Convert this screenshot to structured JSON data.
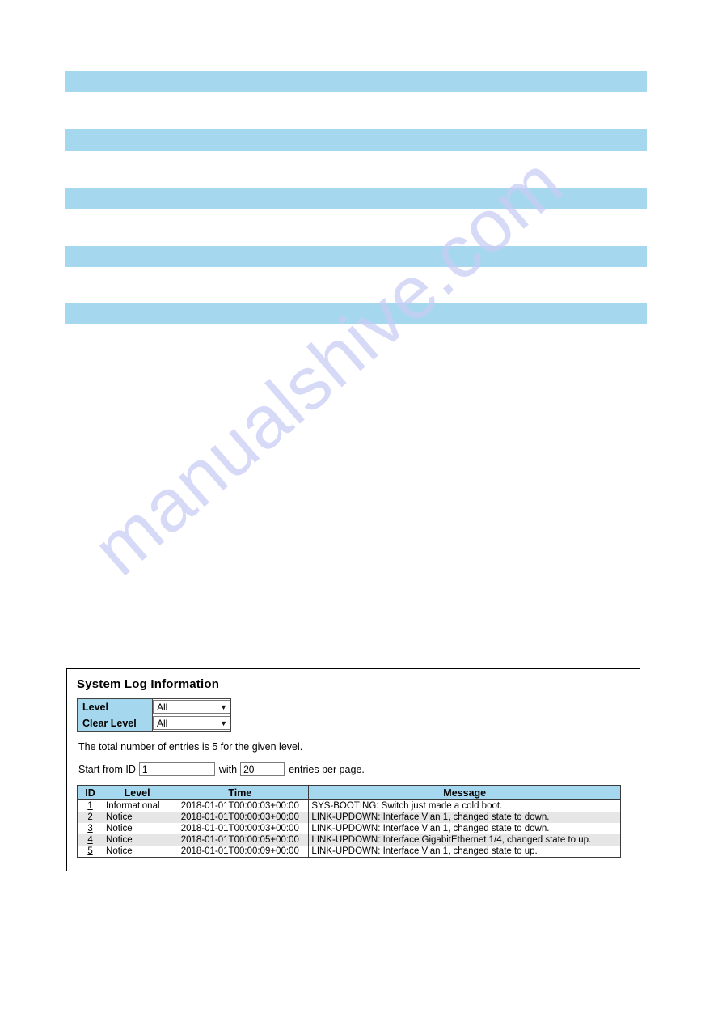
{
  "page": {
    "watermark_text": "manualshive.com",
    "redacted_bar_color": "#a5d8ef",
    "header_blue": "#a5d8ef",
    "alt_row_gray": "#e6e6e6"
  },
  "redacted_bars": [
    {
      "id": "bar-1"
    },
    {
      "id": "bar-2"
    },
    {
      "id": "bar-3"
    },
    {
      "id": "bar-4"
    },
    {
      "id": "bar-5"
    }
  ],
  "panel": {
    "title": "System Log Information",
    "level_form": {
      "rows": [
        {
          "label": "Level",
          "value": "All",
          "caret": "▼"
        },
        {
          "label": "Clear Level",
          "value": "All",
          "caret": "▼"
        }
      ]
    },
    "total_text": "The total number of entries is 5 for the given level.",
    "paging": {
      "prefix": "Start from ID",
      "start_id": "1",
      "middle": "with",
      "per_page": "20",
      "suffix": "entries per page."
    },
    "log_table": {
      "columns": [
        "ID",
        "Level",
        "Time",
        "Message"
      ],
      "rows": [
        {
          "id": "1",
          "level": "Informational",
          "time": "2018-01-01T00:00:03+00:00",
          "message": "SYS-BOOTING: Switch just made a cold boot."
        },
        {
          "id": "2",
          "level": "Notice",
          "time": "2018-01-01T00:00:03+00:00",
          "message": "LINK-UPDOWN: Interface Vlan 1, changed state to down."
        },
        {
          "id": "3",
          "level": "Notice",
          "time": "2018-01-01T00:00:03+00:00",
          "message": "LINK-UPDOWN: Interface Vlan 1, changed state to down."
        },
        {
          "id": "4",
          "level": "Notice",
          "time": "2018-01-01T00:00:05+00:00",
          "message": "LINK-UPDOWN: Interface GigabitEthernet 1/4, changed state to up."
        },
        {
          "id": "5",
          "level": "Notice",
          "time": "2018-01-01T00:00:09+00:00",
          "message": "LINK-UPDOWN: Interface Vlan 1, changed state to up."
        }
      ]
    }
  }
}
